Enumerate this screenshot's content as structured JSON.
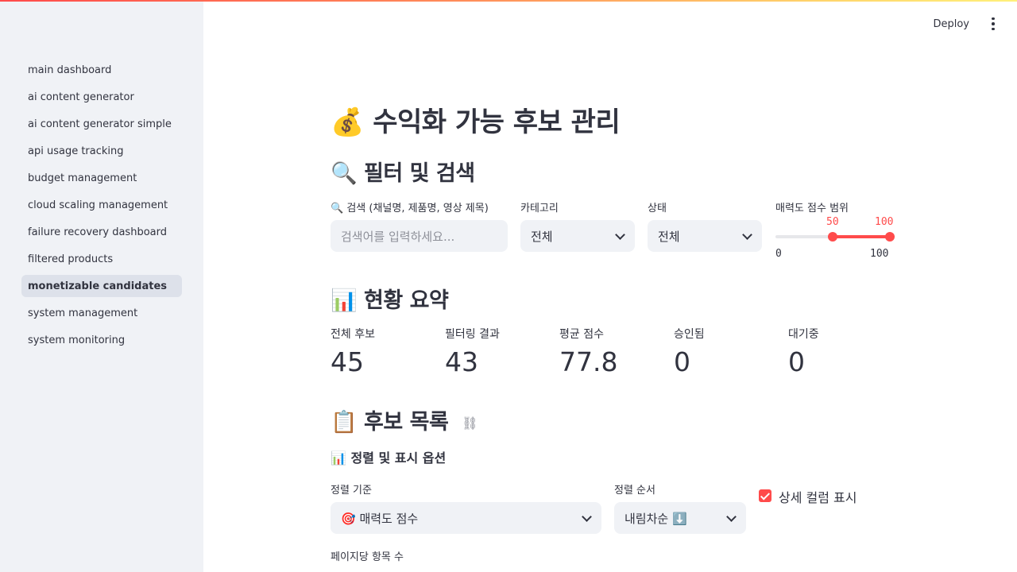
{
  "header": {
    "deploy_label": "Deploy",
    "menu_icon": "more-vert-icon"
  },
  "sidebar": {
    "items": [
      {
        "label": "main dashboard",
        "active": false
      },
      {
        "label": "ai content generator",
        "active": false
      },
      {
        "label": "ai content generator simple",
        "active": false
      },
      {
        "label": "api usage tracking",
        "active": false
      },
      {
        "label": "budget management",
        "active": false
      },
      {
        "label": "cloud scaling management",
        "active": false
      },
      {
        "label": "failure recovery dashboard",
        "active": false
      },
      {
        "label": "filtered products",
        "active": false
      },
      {
        "label": "monetizable candidates",
        "active": true
      },
      {
        "label": "system management",
        "active": false
      },
      {
        "label": "system monitoring",
        "active": false
      }
    ]
  },
  "page": {
    "title_emoji": "💰",
    "title": "수익화 가능 후보 관리"
  },
  "filters": {
    "heading_emoji": "🔍",
    "heading": "필터 및 검색",
    "search": {
      "label": "🔍 검색 (채널명, 제품명, 영상 제목)",
      "placeholder": "검색어를 입력하세요..."
    },
    "category": {
      "label": "카테고리",
      "value": "전체"
    },
    "status": {
      "label": "상태",
      "value": "전체"
    },
    "score_range": {
      "label": "매력도 점수 범위",
      "low": "50",
      "high": "100",
      "min": "0",
      "max": "100"
    }
  },
  "summary": {
    "heading_emoji": "📊",
    "heading": "현황 요약",
    "metrics": [
      {
        "label": "전체 후보",
        "value": "45"
      },
      {
        "label": "필터링 결과",
        "value": "43"
      },
      {
        "label": "평균 점수",
        "value": "77.8"
      },
      {
        "label": "승인됨",
        "value": "0"
      },
      {
        "label": "대기중",
        "value": "0"
      }
    ]
  },
  "candidates": {
    "heading_emoji": "📋",
    "heading": "후보 목록",
    "link_icon": "link-icon",
    "options_emoji": "📊",
    "options_heading": "정렬 및 표시 옵션",
    "sort_by": {
      "label": "정렬 기준",
      "value": "🎯 매력도 점수"
    },
    "sort_order": {
      "label": "정렬 순서",
      "value": "내림차순 ⬇️"
    },
    "detail_columns": {
      "label": "상세 컬럼 표시",
      "checked": true
    },
    "page_size_label": "페이지당 항목 수"
  },
  "colors": {
    "accent": "#ff4b4b",
    "sidebar_bg": "#f0f2f6",
    "field_bg": "#f0f2f6",
    "text": "#31333f"
  }
}
